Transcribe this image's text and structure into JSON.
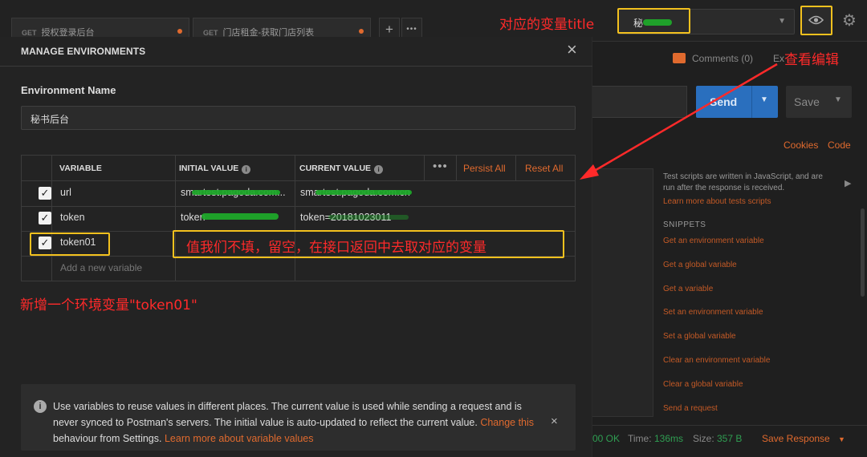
{
  "tabs": [
    {
      "method": "GET",
      "name": "授权登录后台"
    },
    {
      "method": "GET",
      "name": "门店租金-获取门店列表"
    }
  ],
  "tab_actions": {
    "add": "+",
    "more": "•••"
  },
  "env_dropdown": {
    "value": "秘"
  },
  "header_actions": {
    "comments": "Comments (0)",
    "examples": "Ex"
  },
  "request": {
    "send": "Send",
    "save": "Save"
  },
  "links": {
    "cookies": "Cookies",
    "code": "Code"
  },
  "snippets": {
    "description": "Test scripts are written in JavaScript, and are run after the response is received.",
    "learn_more": "Learn more about tests scripts",
    "heading": "SNIPPETS",
    "items": [
      "Get an environment variable",
      "Get a global variable",
      "Get a variable",
      "Set an environment variable",
      "Set a global variable",
      "Clear an environment variable",
      "Clear a global variable",
      "Send a request"
    ]
  },
  "status_bar": {
    "status": "00 OK",
    "time_label": "Time:",
    "time_value": "136ms",
    "size_label": "Size:",
    "size_value": "357 B",
    "save_response": "Save Response"
  },
  "modal": {
    "title": "MANAGE ENVIRONMENTS",
    "close": "×",
    "env_name_label": "Environment Name",
    "env_name_value": "秘书后台",
    "columns": {
      "variable": "VARIABLE",
      "initial": "INITIAL VALUE",
      "current": "CURRENT VALUE"
    },
    "more": "•••",
    "persist_all": "Persist All",
    "reset_all": "Reset All",
    "rows": [
      {
        "checked": true,
        "variable": "url",
        "initial": "smartest.pagoda.com...",
        "current": "smartest.pagoda.com.cn"
      },
      {
        "checked": true,
        "variable": "token",
        "initial": "token",
        "current": "token=20181023011"
      },
      {
        "checked": true,
        "variable": "token01",
        "initial": "",
        "current": ""
      }
    ],
    "add_placeholder": "Add a new variable",
    "info": {
      "text": "Use variables to reuse values in different places. The current value is used while sending a request and is never synced to Postman's servers. The initial value is auto-updated to reflect the current value.",
      "link1": "Change this",
      "text2": "behaviour from Settings.",
      "link2": "Learn more about variable values",
      "close": "×"
    }
  },
  "annotations": {
    "env_title": "对应的变量title",
    "view_edit": "查看编辑",
    "empty_value": "值我们不填，留空，在接口返回中去取对应的变量",
    "new_var": "新增一个环境变量\"token01\""
  },
  "colors": {
    "accent": "#e06a2e",
    "annotation_red": "#ff2a2a",
    "annotation_box": "#f3c11e",
    "send_blue": "#2a6fbe"
  }
}
